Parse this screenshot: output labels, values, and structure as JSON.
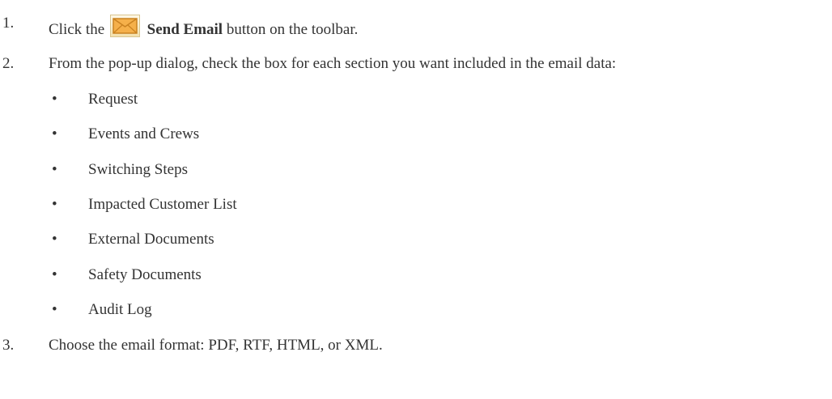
{
  "steps": [
    {
      "number": "1.",
      "text_before": "Click the",
      "icon": "send-email-envelope-icon",
      "bold": "Send Email",
      "text_after": " button on the toolbar."
    },
    {
      "number": "2.",
      "text": "From the pop-up dialog, check the box for each section you want included in the email data:"
    },
    {
      "number": "3.",
      "text": "Choose the email format: PDF, RTF, HTML, or XML."
    }
  ],
  "bullet_glyph": "•",
  "sections": [
    "Request",
    "Events and Crews",
    "Switching Steps",
    "Impacted Customer List",
    "External Documents",
    "Safety Documents",
    "Audit Log"
  ],
  "colors": {
    "text": "#333333",
    "icon_envelope": "#f2a93b"
  }
}
